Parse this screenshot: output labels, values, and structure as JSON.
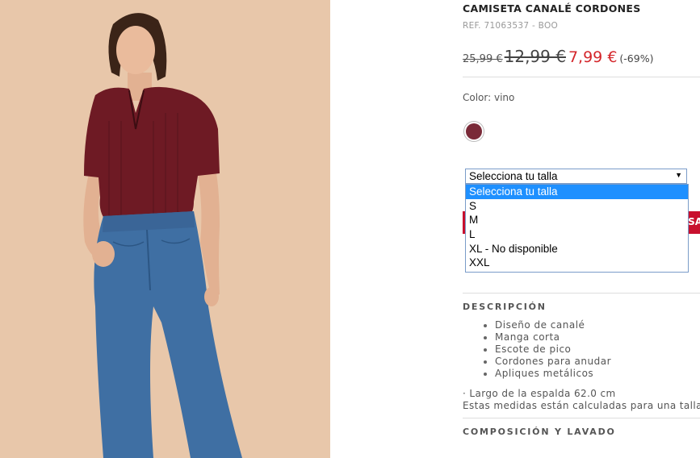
{
  "product": {
    "title": "CAMISETA CANALÉ CORDONES",
    "ref": "REF. 71063537 - BOO",
    "price_original": "25,99 €",
    "price_previous": "12,99 €",
    "price_current": "7,99 €",
    "discount": "(-69%)",
    "color_label": "Color: vino",
    "color_swatch": "#7a2a38",
    "image_alt": "model-wearing-wine-ribbed-top-and-flare-jeans"
  },
  "size_select": {
    "selected": "Selecciona tu talla",
    "options": [
      "Selecciona tu talla",
      "S",
      "M",
      "L",
      "XL - No disponible",
      "XXL"
    ]
  },
  "cta": {
    "label": "SA"
  },
  "description": {
    "title": "DESCRIPCIÓN",
    "features": [
      "Diseño de canalé",
      "Manga corta",
      "Escote de pico",
      "Cordones para anudar",
      "Apliques metálicos"
    ],
    "length": "· Largo de la espalda 62.0 cm",
    "note": "Estas medidas están calculadas para una talla"
  },
  "composition": {
    "title": "COMPOSICIÓN Y LAVADO"
  },
  "colors": {
    "price_red": "#d4262b",
    "cta_red": "#c8102e",
    "select_highlight": "#1e90ff"
  }
}
